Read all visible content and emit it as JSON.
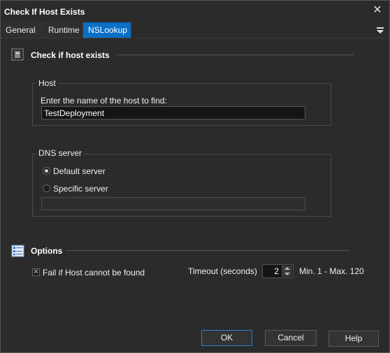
{
  "window": {
    "title": "Check If Host Exists",
    "close_glyph": "✕"
  },
  "tabs": [
    {
      "label": "General"
    },
    {
      "label": "Runtime"
    },
    {
      "label": "NSLookup"
    }
  ],
  "active_tab": "NSLookup",
  "section_check": {
    "title": "Check if host exists",
    "icon": "host-check-icon"
  },
  "host_group": {
    "legend": "Host",
    "prompt": "Enter the name of the host to find:",
    "value": "TestDeployment"
  },
  "dns_group": {
    "legend": "DNS server",
    "option_default": "Default server",
    "option_specific": "Specific server",
    "selected": "Default server",
    "specific_value": ""
  },
  "section_options": {
    "title": "Options",
    "icon": "options-icon"
  },
  "options": {
    "fail_label": "Fail if Host cannot be found",
    "fail_checked": true,
    "timeout_label": "Timeout (seconds)",
    "timeout_value": "2",
    "timeout_range": "Min. 1 - Max. 120"
  },
  "buttons": {
    "ok": "OK",
    "cancel": "Cancel",
    "help": "Help"
  },
  "colors": {
    "background": "#2b2b2b",
    "accent": "#0a6fc7"
  }
}
